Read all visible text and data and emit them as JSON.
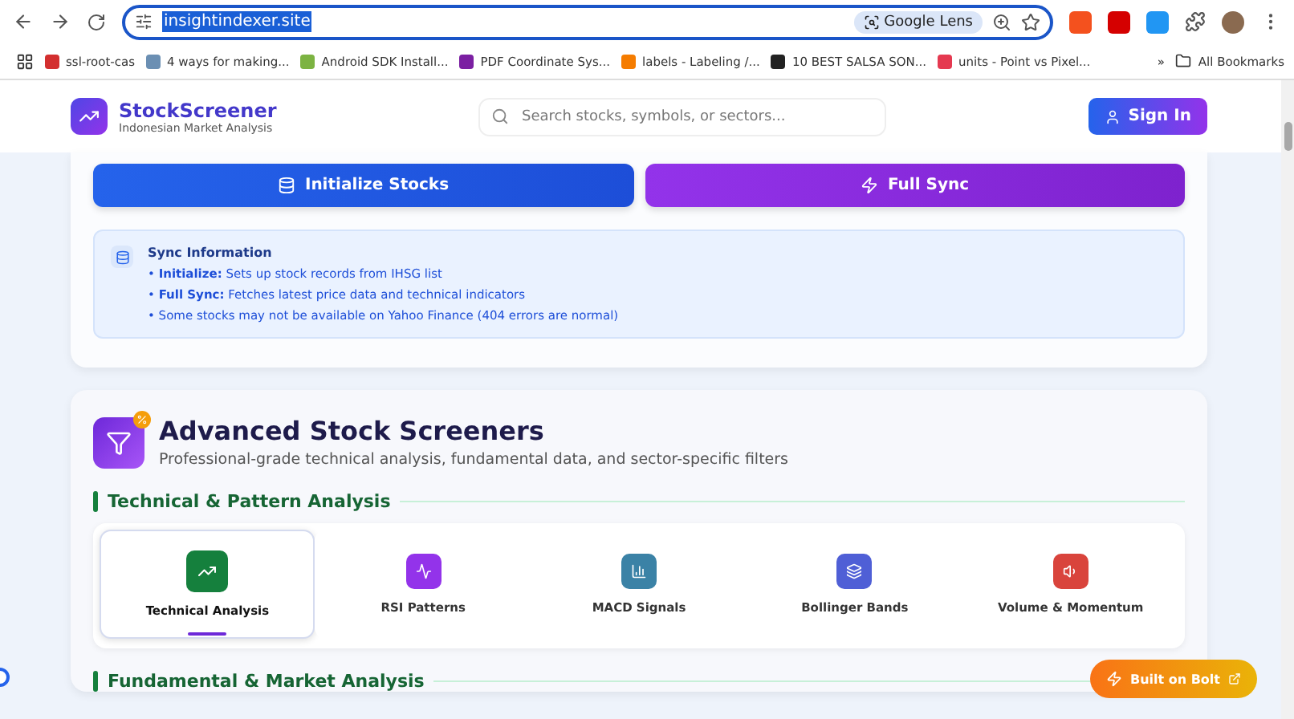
{
  "browser": {
    "url": "insightindexer.site",
    "lens": "Google Lens",
    "bookmarks": [
      {
        "label": "ssl-root-cas",
        "color": "#d32f2f"
      },
      {
        "label": "4 ways for making...",
        "color": "#6b8fb3"
      },
      {
        "label": "Android SDK Install...",
        "color": "#7cb342"
      },
      {
        "label": "PDF Coordinate Sys...",
        "color": "#7b1fa2"
      },
      {
        "label": "labels - Labeling /...",
        "color": "#f57c00"
      },
      {
        "label": "10 BEST SALSA SON...",
        "color": "#222222"
      },
      {
        "label": "units - Point vs Pixel...",
        "color": "#e53950"
      }
    ],
    "more": "»",
    "all_bookmarks": "All Bookmarks"
  },
  "header": {
    "brand": "StockScreener",
    "tagline": "Indonesian Market Analysis",
    "search": {
      "placeholder": "Search stocks, symbols, or sectors..."
    },
    "sign_in": "Sign In"
  },
  "sync": {
    "buttons": [
      {
        "label": "Initialize Stocks",
        "kind": "database"
      },
      {
        "label": "Full Sync",
        "kind": "zap"
      }
    ],
    "info": {
      "title": "Sync Information",
      "lines": [
        "• **Initialize:** Sets up stock records from IHSG list",
        "• **Full Sync:** Fetches latest price data and technical indicators",
        "• Some stocks may not be available on Yahoo Finance (404 errors are normal)"
      ]
    }
  },
  "screeners": {
    "title": "Advanced Stock Screeners",
    "subtitle": "Professional-grade technical analysis, fundamental data, and sector-specific filters",
    "sections": [
      {
        "title": "Technical & Pattern Analysis",
        "tabs": [
          {
            "label": "Technical Analysis",
            "kind": "trend",
            "color": "#15803d",
            "selected": true
          },
          {
            "label": "RSI Patterns",
            "kind": "pulse",
            "color": "#9333ea",
            "selected": false
          },
          {
            "label": "MACD Signals",
            "kind": "bars",
            "color": "#3b82a6",
            "selected": false
          },
          {
            "label": "Bollinger Bands",
            "kind": "layers",
            "color": "#4f5fd6",
            "selected": false
          },
          {
            "label": "Volume & Momentum",
            "kind": "volume",
            "color": "#d9443c",
            "selected": false
          }
        ]
      },
      {
        "title": "Fundamental & Market Analysis"
      }
    ]
  },
  "badge": {
    "label": "Built on Bolt"
  }
}
